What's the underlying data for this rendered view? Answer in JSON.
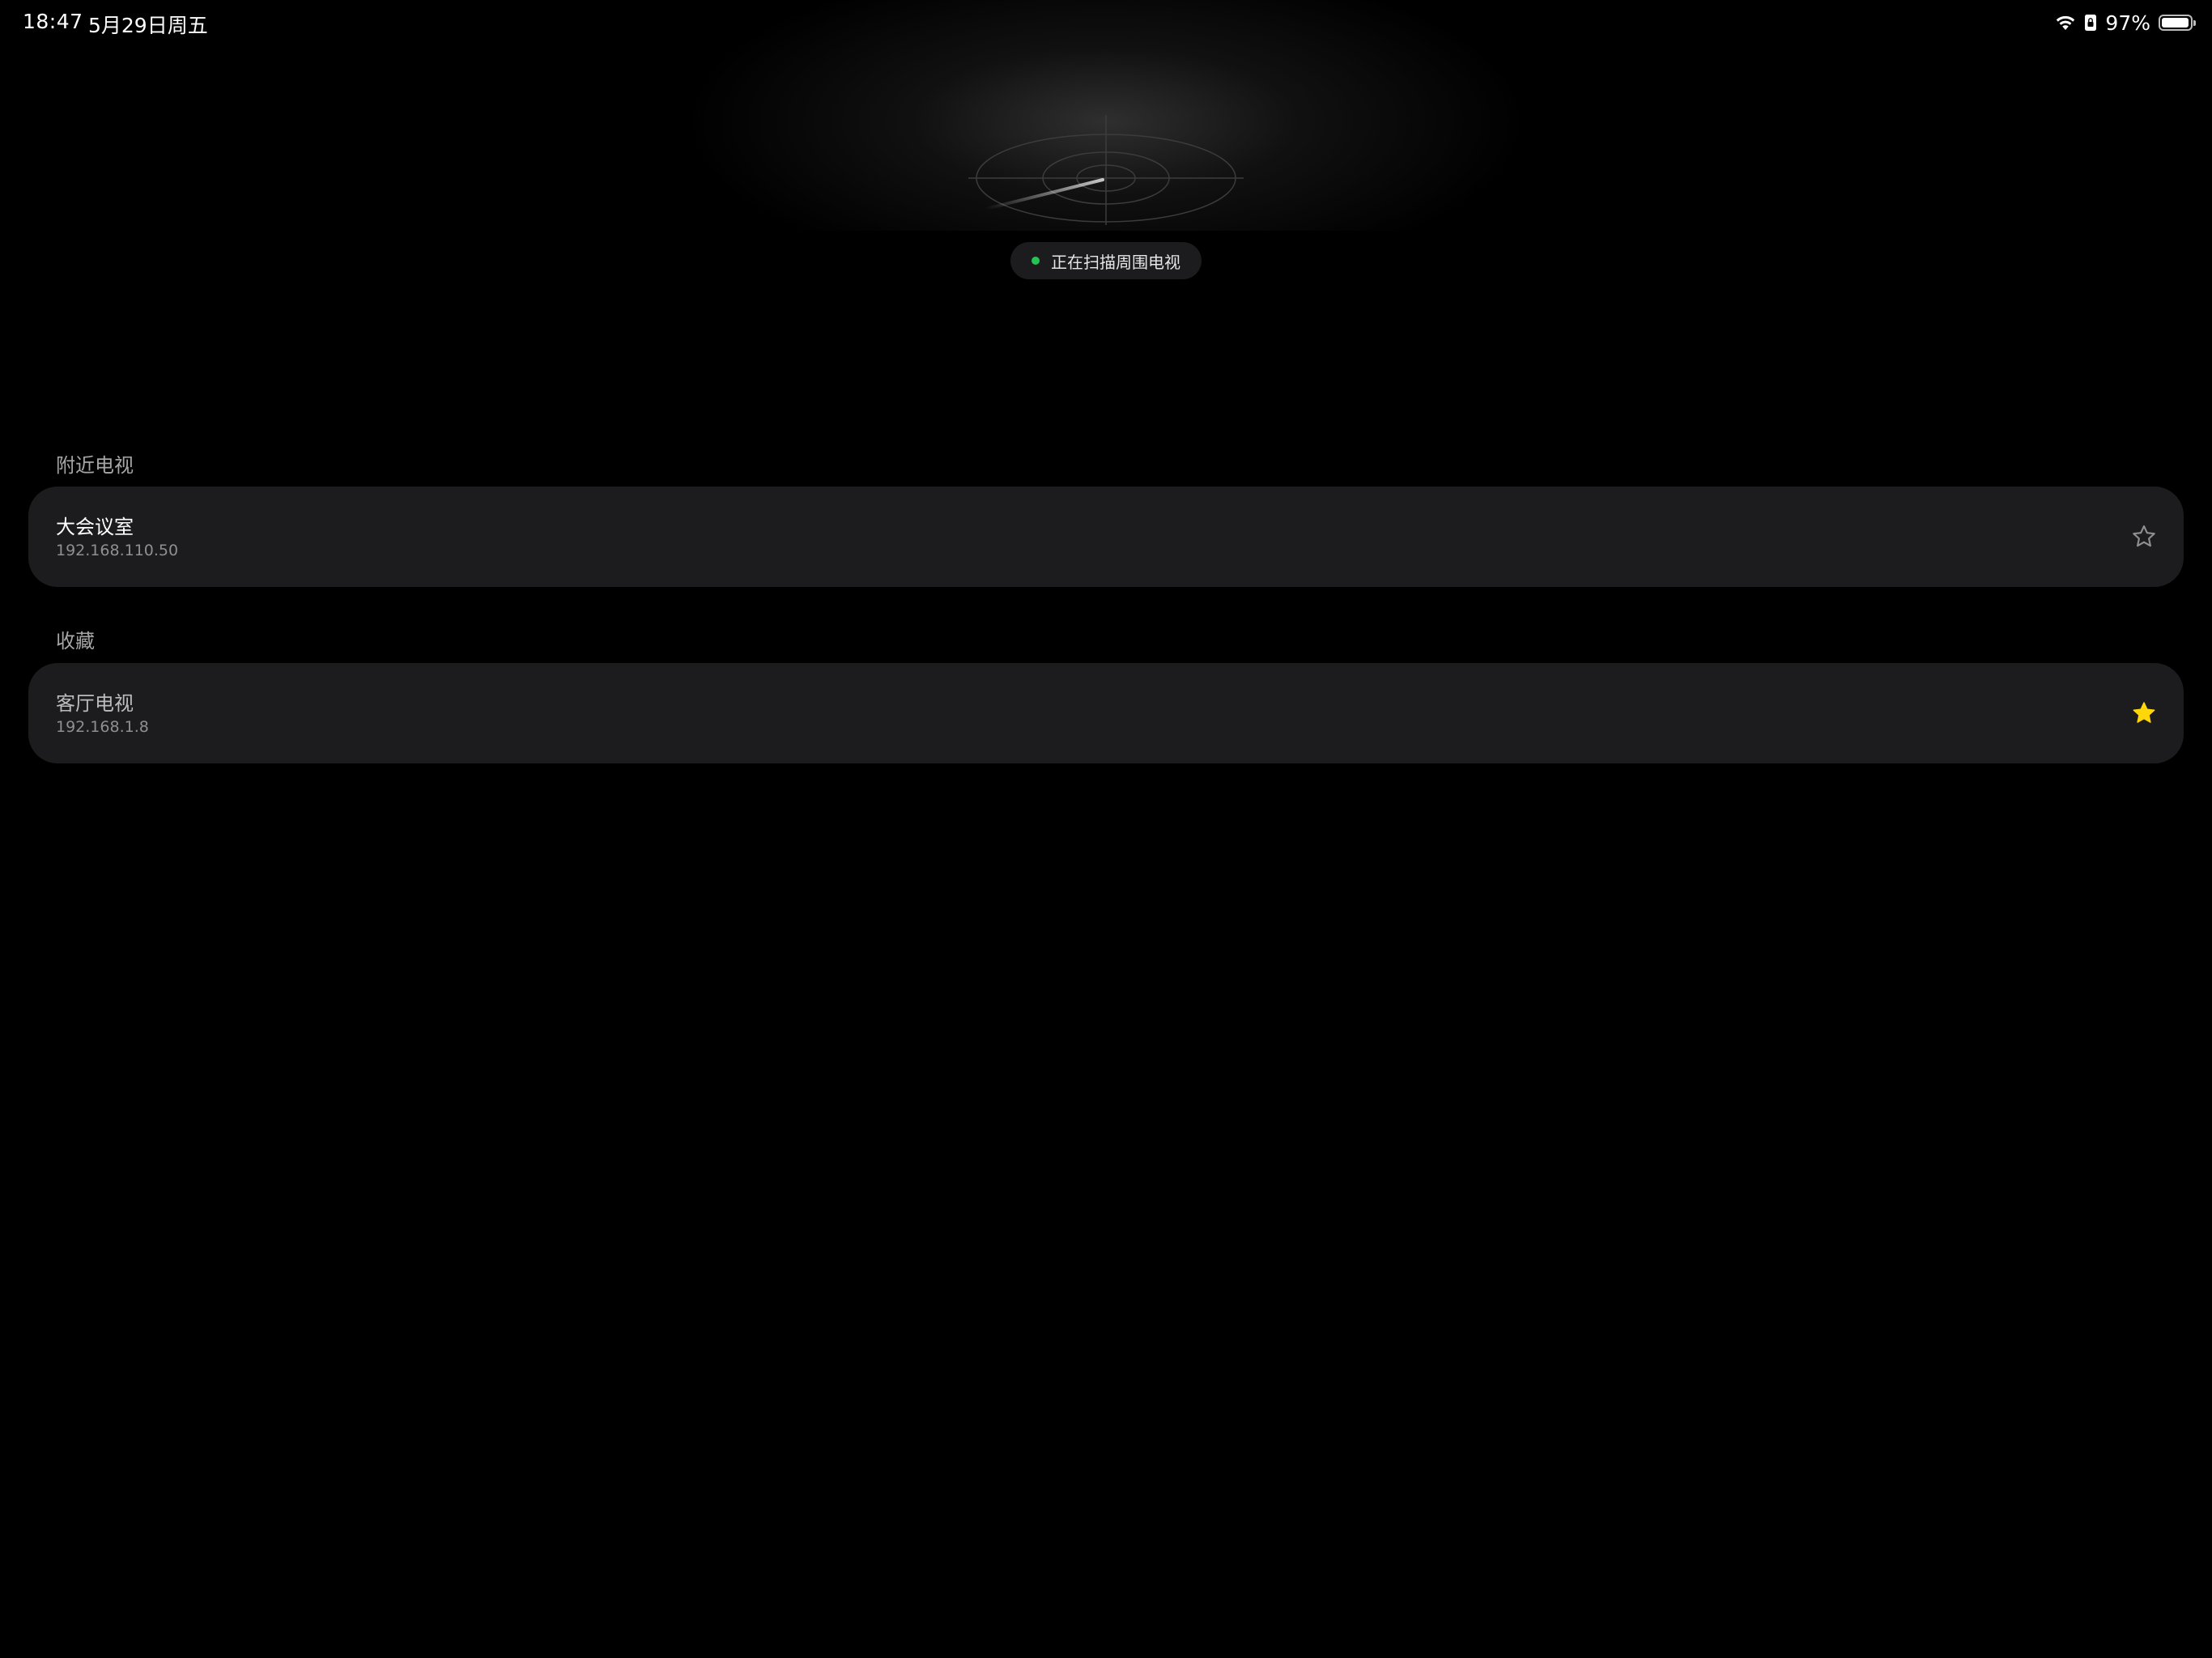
{
  "status_bar": {
    "time": "18:47",
    "date": "5月29日周五",
    "battery_percent": "97%",
    "battery_level": 0.97,
    "icons": [
      "wifi-icon",
      "portrait-lock-icon",
      "battery-icon"
    ]
  },
  "scanner": {
    "status_text": "正在扫描周围电视",
    "indicator_color": "#23c552"
  },
  "sections": [
    {
      "title": "附近电视",
      "devices": [
        {
          "name": "大会议室",
          "ip": "192.168.110.50",
          "favorite": false
        }
      ]
    },
    {
      "title": "收藏",
      "devices": [
        {
          "name": "客厅电视",
          "ip": "192.168.1.8",
          "favorite": true
        }
      ]
    }
  ],
  "colors": {
    "background": "#000000",
    "card": "#1c1c1e",
    "favorite_star": "#ffd60a",
    "inactive_star": "#8e8e93"
  }
}
